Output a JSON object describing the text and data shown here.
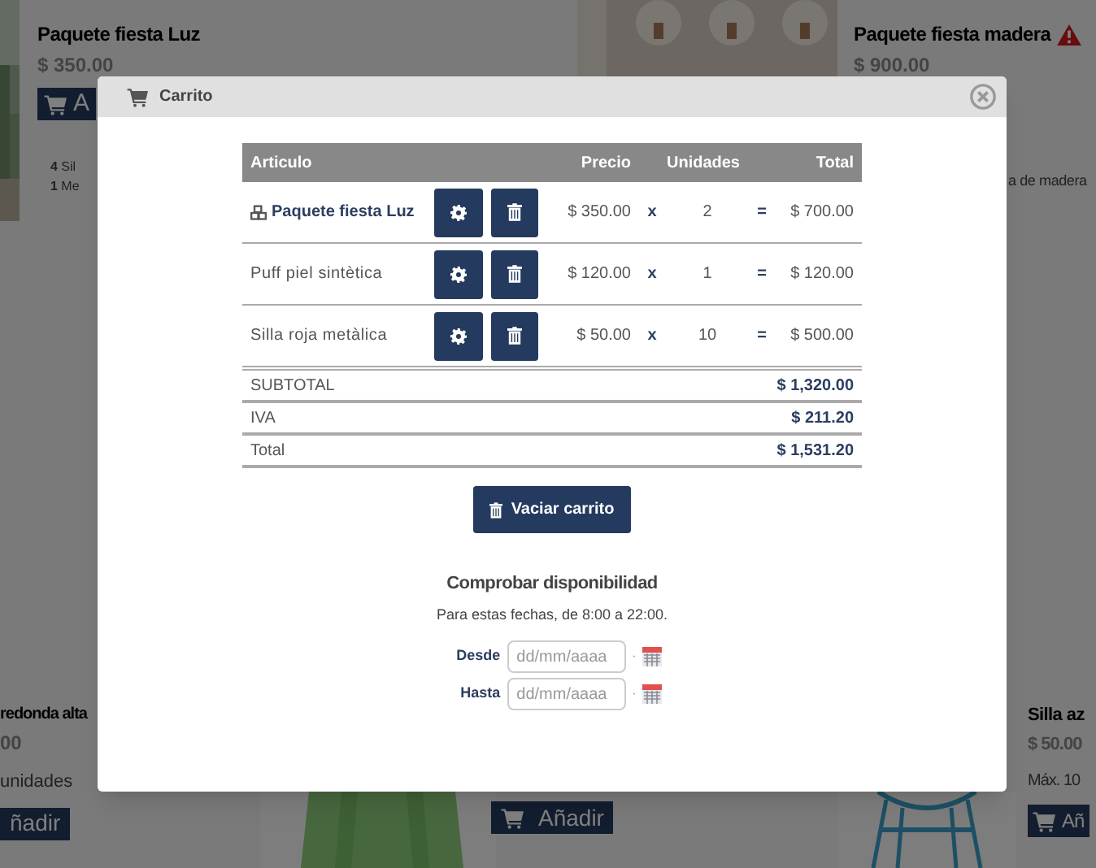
{
  "background": {
    "cards": [
      {
        "title": "Paquete fiesta Luz",
        "price": "$ 350.00",
        "button": "A",
        "items": [
          {
            "count": "4",
            "text": "Sil"
          },
          {
            "count": "1",
            "text": "Me"
          }
        ]
      },
      {
        "title": "Paquete fiesta madera",
        "warning": true,
        "price": "$ 900.00",
        "note": "a de madera"
      },
      {
        "title": "redonda alta",
        "price": "00",
        "note": "unidades",
        "button": "ñadir"
      },
      {
        "button": "Añadir"
      },
      {
        "title": "Silla az",
        "price": "$ 50.00",
        "note": "Máx. 10",
        "button": "Añ"
      }
    ]
  },
  "modal": {
    "title": "Carrito",
    "table": {
      "columns": [
        "Articulo",
        "Precio",
        "Unidades",
        "Total"
      ],
      "rows": [
        {
          "kind": "package",
          "name": "Paquete fiesta Luz",
          "price": "$ 350.00",
          "times": "x",
          "units": "2",
          "equals": "=",
          "total": "$ 700.00"
        },
        {
          "kind": "item",
          "name": "Puff piel sintètica",
          "price": "$ 120.00",
          "times": "x",
          "units": "1",
          "equals": "=",
          "total": "$ 120.00"
        },
        {
          "kind": "item",
          "name": "Silla roja metàlica",
          "price": "$ 50.00",
          "times": "x",
          "units": "10",
          "equals": "=",
          "total": "$ 500.00"
        }
      ],
      "summary": [
        {
          "label": "SUBTOTAL",
          "value": "$ 1,320.00"
        },
        {
          "label": "IVA",
          "value": "$ 211.20"
        },
        {
          "label": "Total",
          "value": "$ 1,531.20"
        }
      ]
    },
    "clear_button": "Vaciar carrito",
    "availability": {
      "title": "Comprobar disponibilidad",
      "subtitle": "Para estas fechas, de 8:00 a 22:00.",
      "fields": [
        {
          "label": "Desde",
          "placeholder": "dd/mm/aaaa",
          "separator": "·"
        },
        {
          "label": "Hasta",
          "placeholder": "dd/mm/aaaa",
          "separator": "·"
        }
      ]
    }
  }
}
